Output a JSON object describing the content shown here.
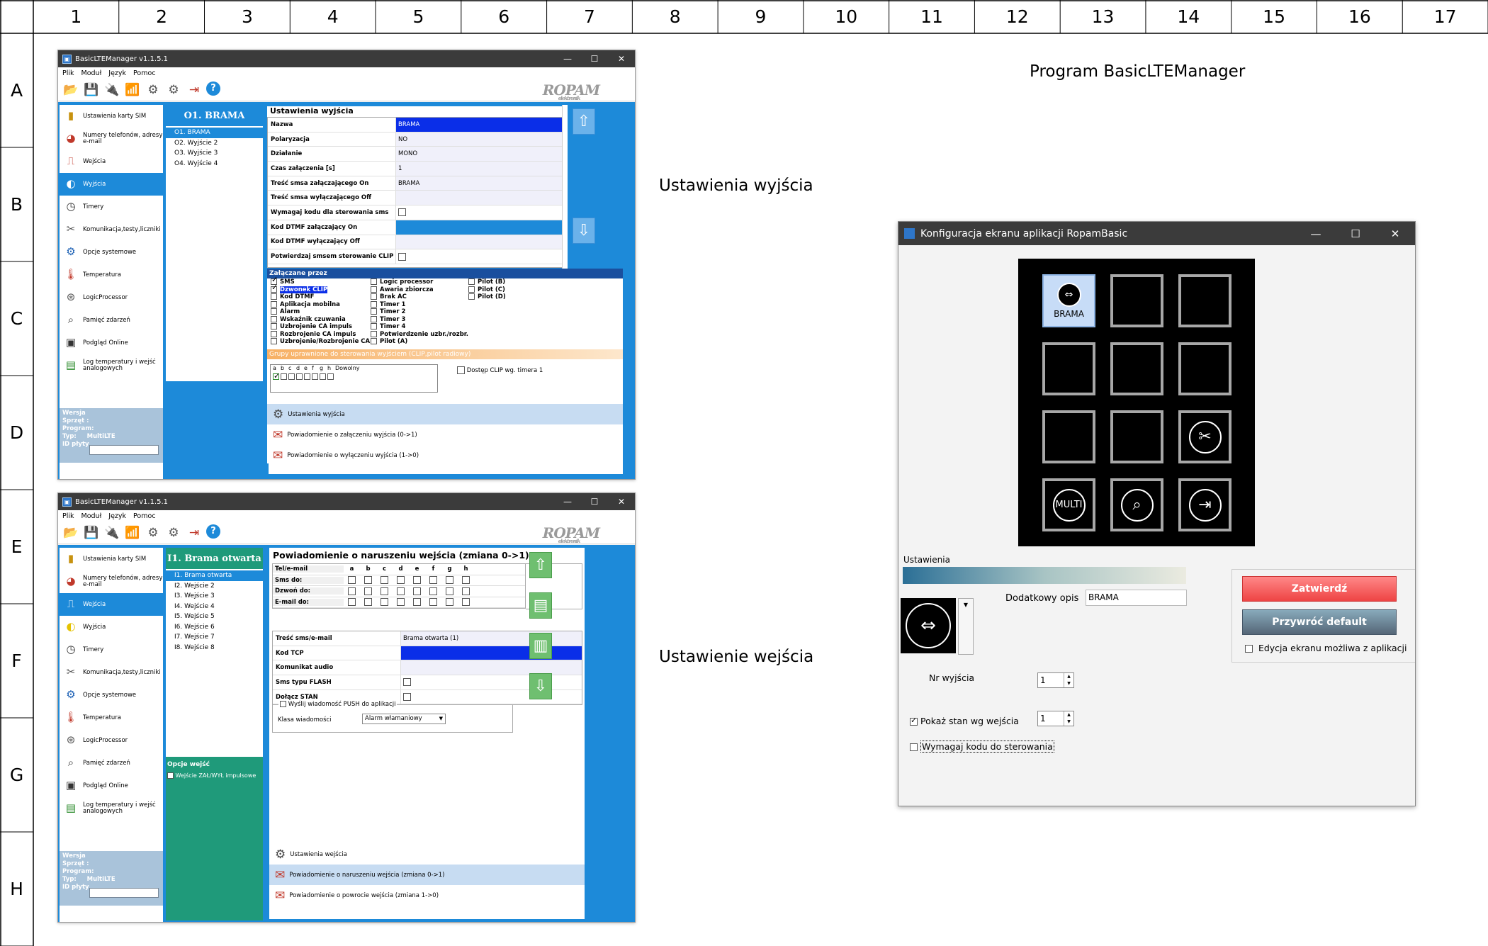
{
  "grid": {
    "columns": [
      "1",
      "2",
      "3",
      "4",
      "5",
      "6",
      "7",
      "8",
      "9",
      "10",
      "11",
      "12",
      "13",
      "14",
      "15",
      "16",
      "17"
    ],
    "rows": [
      "A",
      "B",
      "C",
      "D",
      "E",
      "F",
      "G",
      "H"
    ]
  },
  "captions": {
    "program": "Program BasicLTEManager",
    "outputs": "Ustawienia wyjścia",
    "inputs": "Ustawienie wejścia"
  },
  "app": {
    "title": "BasicLTEManager v1.1.5.1",
    "menu": [
      "Plik",
      "Moduł",
      "Język",
      "Pomoc"
    ],
    "toolbar_icons": [
      "folder-icon",
      "save-icon",
      "usb-icon",
      "antenna-icon",
      "chip-icon",
      "chip2-icon",
      "exit-icon",
      "help-icon"
    ],
    "logo": "ROPAM",
    "logo_sub": "elektronik",
    "nav": [
      {
        "label": "Ustawienia karty SIM",
        "icon": "sim-card-icon"
      },
      {
        "label": "Numery telefonów, adresy e-mail",
        "icon": "contacts-icon"
      },
      {
        "label": "Wejścia",
        "icon": "input-icon"
      },
      {
        "label": "Wyjścia",
        "icon": "output-icon"
      },
      {
        "label": "Timery",
        "icon": "timer-icon"
      },
      {
        "label": "Komunikacja,testy,liczniki",
        "icon": "tools-icon"
      },
      {
        "label": "Opcje systemowe",
        "icon": "gear-icon"
      },
      {
        "label": "Temperatura",
        "icon": "thermometer-icon"
      },
      {
        "label": "LogicProcessor",
        "icon": "logic-icon"
      },
      {
        "label": "Pamięć zdarzeń",
        "icon": "search-icon"
      },
      {
        "label": "Podgląd Online",
        "icon": "monitor-icon"
      },
      {
        "label": "Log temperatury i wejść analogowych",
        "icon": "log-icon"
      }
    ],
    "version": {
      "labels": [
        "Wersja",
        "Sprzęt :",
        "Program:",
        "Typ:",
        "ID płyty"
      ],
      "type_value": "MultiLTE"
    }
  },
  "outputs_window": {
    "list_title": "O1. BRAMA",
    "list": [
      "O1. BRAMA",
      "O2. Wyjście 2",
      "O3. Wyjście 3",
      "O4. Wyjście 4"
    ],
    "props_title": "Ustawienia wyjścia",
    "props": [
      {
        "k": "Nazwa",
        "v": "BRAMA",
        "style": "blue"
      },
      {
        "k": "Polaryzacja",
        "v": "NO"
      },
      {
        "k": "Działanie",
        "v": "MONO"
      },
      {
        "k": "Czas załączenia [s]",
        "v": "1"
      },
      {
        "k": "Treść smsa załączającego On",
        "v": "BRAMA"
      },
      {
        "k": "Treść smsa wyłączającego Off",
        "v": ""
      },
      {
        "k": "Wymagaj kodu dla sterowania sms",
        "v": "",
        "chk": true
      },
      {
        "k": "Kod DTMF załączający On",
        "v": "",
        "style": "lightblue"
      },
      {
        "k": "Kod DTMF wyłączający Off",
        "v": ""
      },
      {
        "k": "Potwierdzaj smsem sterowanie CLIP",
        "v": "",
        "chk": true
      }
    ],
    "enabled_by_title": "Załączane przez",
    "enabled_col1": [
      {
        "t": "SMS",
        "on": true
      },
      {
        "t": "Dzwonek CLIP",
        "on": true,
        "sel": true
      },
      {
        "t": "Kod DTMF"
      },
      {
        "t": "Aplikacja mobilna"
      },
      {
        "t": "Alarm"
      },
      {
        "t": "Wskaźnik czuwania"
      },
      {
        "t": "Uzbrojenie CA impuls"
      },
      {
        "t": "Rozbrojenie CA impuls"
      },
      {
        "t": "Uzbrojenie/Rozbrojenie CA"
      }
    ],
    "enabled_col2": [
      {
        "t": "Logic processor"
      },
      {
        "t": "Awaria zbiorcza"
      },
      {
        "t": "Brak AC"
      },
      {
        "t": "Timer 1"
      },
      {
        "t": "Timer 2"
      },
      {
        "t": "Timer 3"
      },
      {
        "t": "Timer 4"
      },
      {
        "t": "Potwierdzenie uzbr./rozbr."
      },
      {
        "t": "Pilot (A)"
      }
    ],
    "enabled_col3": [
      {
        "t": "Pilot (B)"
      },
      {
        "t": "Pilot (C)"
      },
      {
        "t": "Pilot (D)"
      }
    ],
    "groups_title": "Grupy uprawnione do sterowania  wyjściem (CLIP,pilot radiowy)",
    "groups_letters": [
      "a",
      "b",
      "c",
      "d",
      "e",
      "f",
      "g",
      "h",
      "Dowolny"
    ],
    "clip_timer": "Dostęp CLIP wg. timera 1",
    "tabs": [
      "Ustawienia wyjścia",
      "Powiadomienie o załączeniu wyjścia (0->1)",
      "Powiadomienie o wyłączeniu wyjścia (1->0)"
    ]
  },
  "inputs_window": {
    "list_title": "I1. Brama otwarta",
    "list": [
      "I1. Brama otwarta",
      "I2. Wejście 2",
      "I3. Wejście 3",
      "I4. Wejście 4",
      "I5. Wejście 5",
      "I6. Wejście 6",
      "I7. Wejście 7",
      "I8. Wejście 8"
    ],
    "options_title": "Opcje wejść",
    "options_item": "Wejście ZAŁ/WYŁ impulsowe",
    "notif_title": "Powiadomienie o naruszeniu wejścia (zmiana 0->1)",
    "notif_cols": [
      "a",
      "b",
      "c",
      "d",
      "e",
      "f",
      "g",
      "h"
    ],
    "notif_rows": [
      "Tel/e-mail",
      "Sms do:",
      "Dzwoń do:",
      "E-mail do:"
    ],
    "props": [
      {
        "k": "Treść sms/e-mail",
        "v": "Brama otwarta (1)"
      },
      {
        "k": "Kod TCP",
        "v": "",
        "style": "blue"
      },
      {
        "k": "Komunikat audio",
        "v": ""
      },
      {
        "k": "Sms typu FLASH",
        "v": "",
        "chk": true
      },
      {
        "k": "Dołącz STAN",
        "v": "",
        "chk": true
      }
    ],
    "push_label": "Wyślij wiadomość PUSH do aplikacji",
    "msg_class_label": "Klasa wiadomości",
    "msg_class_value": "Alarm włamaniowy",
    "tabs": [
      "Ustawienia wejścia",
      "Powiadomienie o naruszeniu wejścia (zmiana 0->1)",
      "Powiadomienie o powrocie wejścia (zmiana 1->0)"
    ]
  },
  "config_dialog": {
    "title": "Konfiguracja ekranu aplikacji RopamBasic",
    "tile_label": "BRAMA",
    "tile_icons": [
      "gate-icon",
      "empty",
      "empty",
      "empty",
      "empty",
      "empty",
      "empty",
      "empty",
      "tools-icon",
      "multi-icon",
      "search-doc-icon",
      "exit-icon"
    ],
    "multi_text": "MULTI",
    "settings_label": "Ustawienia",
    "extra_desc_label": "Dodatkowy opis",
    "extra_desc_value": "BRAMA",
    "confirm": "Zatwierdź",
    "restore": "Przywróć default",
    "edit_in_app": "Edycja ekranu możliwa z aplikacji",
    "output_no_label": "Nr wyjścia",
    "output_no": "1",
    "show_state_label": "Pokaż stan wg wejścia",
    "show_state_value": "1",
    "require_code_label": "Wymagaj kodu do sterowania",
    "colors": {
      "accent": "#1d8ad9",
      "confirm": "#e44444",
      "restore": "#556677"
    }
  }
}
